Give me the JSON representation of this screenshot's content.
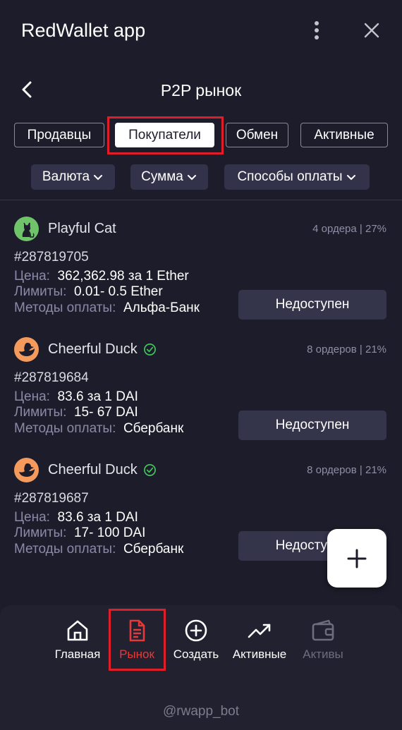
{
  "app": {
    "title": "RedWallet app"
  },
  "header": {
    "title": "P2P рынок"
  },
  "tabs": [
    {
      "label": "Продавцы",
      "active": false
    },
    {
      "label": "Покупатели",
      "active": true
    },
    {
      "label": "Обмен",
      "active": false
    },
    {
      "label": "Активные",
      "active": false
    }
  ],
  "filters": [
    {
      "label": "Валюта"
    },
    {
      "label": "Сумма"
    },
    {
      "label": "Способы оплаты"
    }
  ],
  "orders": [
    {
      "trader": "Playful Cat",
      "verified": false,
      "avatar_color": "#6fc46a",
      "avatar_icon": "cat-icon",
      "stats": "4 ордера | 27%",
      "id": "#287819705",
      "price_label": "Цена:",
      "price": "362,362.98 за 1 Ether",
      "limits_label": "Лимиты:",
      "limits": "0.01- 0.5 Ether",
      "methods_label": "Методы оплаты:",
      "methods": "Альфа-Банк",
      "button": "Недоступен"
    },
    {
      "trader": "Cheerful Duck",
      "verified": true,
      "avatar_color": "#f49a5c",
      "avatar_icon": "duck-icon",
      "stats": "8 ордеров | 21%",
      "id": "#287819684",
      "price_label": "Цена:",
      "price": "83.6 за 1 DAI",
      "limits_label": "Лимиты:",
      "limits": "15- 67 DAI",
      "methods_label": "Методы оплаты:",
      "methods": "Сбербанк",
      "button": "Недоступен"
    },
    {
      "trader": "Cheerful Duck",
      "verified": true,
      "avatar_color": "#f49a5c",
      "avatar_icon": "duck-icon",
      "stats": "8 ордеров | 21%",
      "id": "#287819687",
      "price_label": "Цена:",
      "price": "83.6 за 1 DAI",
      "limits_label": "Лимиты:",
      "limits": "17- 100 DAI",
      "methods_label": "Методы оплаты:",
      "methods": "Сбербанк",
      "button": "Недоступен"
    }
  ],
  "fab": {
    "icon": "plus-icon"
  },
  "nav": [
    {
      "label": "Главная",
      "icon": "home-icon",
      "active": false,
      "disabled": false
    },
    {
      "label": "Рынок",
      "icon": "document-icon",
      "active": true,
      "disabled": false
    },
    {
      "label": "Создать",
      "icon": "plus-circle-icon",
      "active": false,
      "disabled": false
    },
    {
      "label": "Активные",
      "icon": "trending-up-icon",
      "active": false,
      "disabled": false
    },
    {
      "label": "Активы",
      "icon": "wallet-icon",
      "active": false,
      "disabled": true
    }
  ],
  "footer": {
    "handle": "@rwapp_bot"
  },
  "colors": {
    "background": "#1c1c2a",
    "accent": "#e53a3a",
    "highlight": "#e01e2a",
    "verified": "#3fc45a"
  }
}
